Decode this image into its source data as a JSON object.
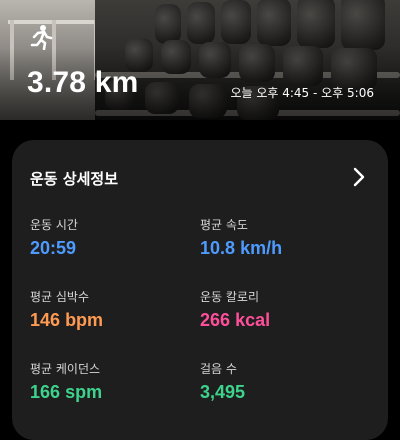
{
  "header": {
    "distance": "3.78 km",
    "time_range": "오늘 오후 4:45 - 오후 5:06",
    "activity_icon": "running-person-icon"
  },
  "details": {
    "title": "운동 상세정보",
    "chevron_icon": "chevron-right-icon",
    "metrics": [
      {
        "label": "운동 시간",
        "value": "20:59",
        "unit": "",
        "color": "#4e9bff"
      },
      {
        "label": "평균 속도",
        "value": "10.8",
        "unit": "km/h",
        "color": "#4e9bff"
      },
      {
        "label": "평균 심박수",
        "value": "146",
        "unit": "bpm",
        "color": "#ff9a52"
      },
      {
        "label": "운동 칼로리",
        "value": "266",
        "unit": "kcal",
        "color": "#ff4f9a"
      },
      {
        "label": "평균 케이던스",
        "value": "166",
        "unit": "spm",
        "color": "#3ed38c"
      },
      {
        "label": "걸음 수",
        "value": "3,495",
        "unit": "",
        "color": "#3ed38c"
      }
    ]
  }
}
